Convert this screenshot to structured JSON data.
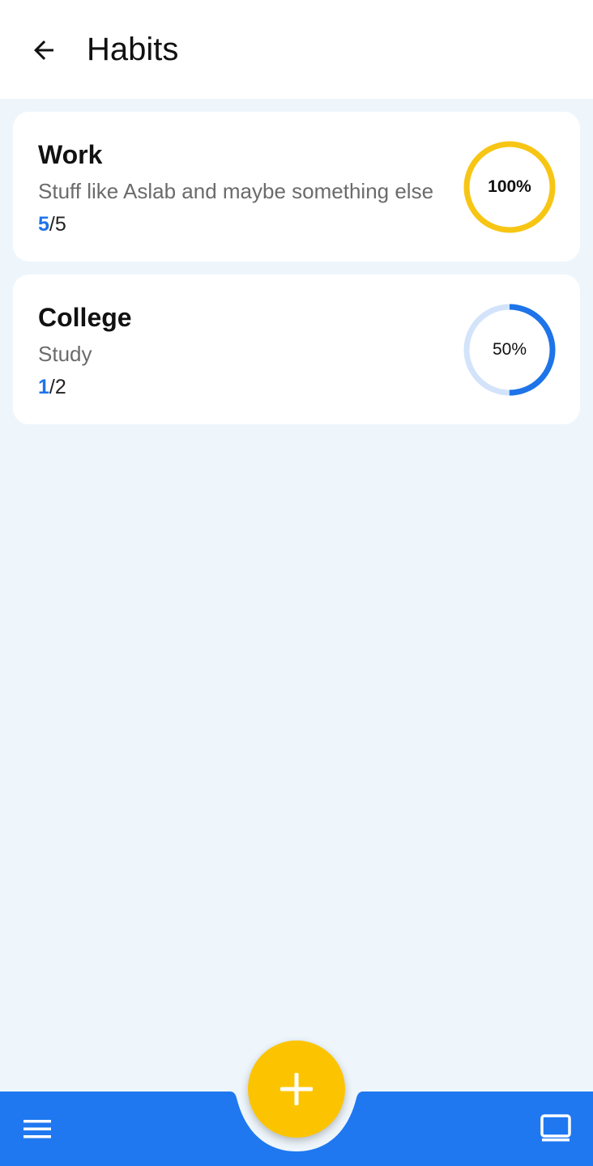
{
  "header": {
    "title": "Habits",
    "back_icon": "arrow-back-icon"
  },
  "colors": {
    "accent_yellow": "#fcc400",
    "accent_blue": "#1e74e8",
    "bottom_bar": "#1f78f0",
    "background": "#eef6fc"
  },
  "habits": [
    {
      "title": "Work",
      "description": "Stuff like Aslab and maybe something else",
      "done": "5",
      "separator": "/",
      "total": "5",
      "progress_label": "100%",
      "progress": 1.0,
      "ring_color": "#f7c514"
    },
    {
      "title": "College",
      "description": "Study",
      "done": "1",
      "separator": "/",
      "total": "2",
      "progress_label": "50%",
      "progress": 0.5,
      "ring_color": "#1e74e8"
    }
  ],
  "bottom_nav": {
    "menu_icon": "menu-icon",
    "add_icon": "plus-icon",
    "view_icon": "view-carousel-icon"
  }
}
